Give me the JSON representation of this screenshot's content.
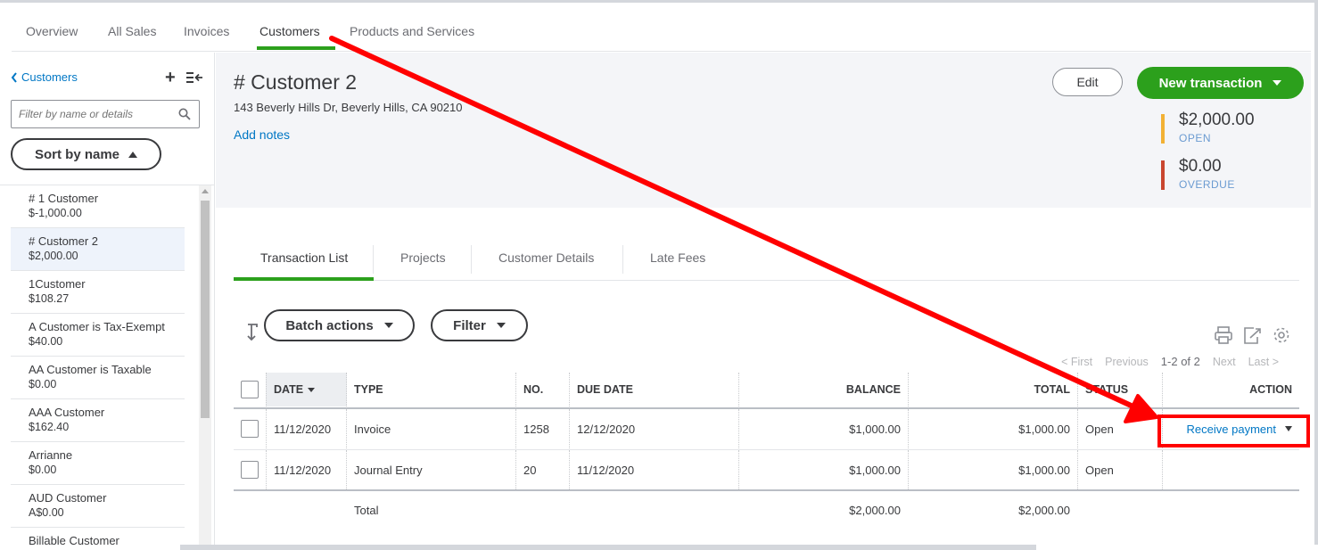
{
  "top_nav": {
    "tabs": [
      {
        "label": "Overview"
      },
      {
        "label": "All Sales"
      },
      {
        "label": "Invoices"
      },
      {
        "label": "Customers"
      },
      {
        "label": "Products and Services"
      }
    ],
    "active_index": 3
  },
  "sidebar": {
    "back_label": "Customers",
    "filter_placeholder": "Filter by name or details",
    "sort_label": "Sort by name",
    "customers": [
      {
        "name": "# 1 Customer",
        "balance": "$-1,000.00"
      },
      {
        "name": "# Customer 2",
        "balance": "$2,000.00",
        "selected": true
      },
      {
        "name": "1Customer",
        "balance": "$108.27"
      },
      {
        "name": "A Customer is Tax-Exempt",
        "balance": "$40.00"
      },
      {
        "name": "AA Customer is Taxable",
        "balance": "$0.00"
      },
      {
        "name": "AAA Customer",
        "balance": "$162.40"
      },
      {
        "name": "Arrianne",
        "balance": "$0.00"
      },
      {
        "name": "AUD Customer",
        "balance": "A$0.00"
      },
      {
        "name": "Billable Customer",
        "balance": ""
      }
    ]
  },
  "header": {
    "title": "# Customer 2",
    "address": "143 Beverly Hills Dr, Beverly Hills, CA 90210",
    "add_notes": "Add notes",
    "edit_label": "Edit",
    "new_transaction_label": "New transaction",
    "open": {
      "value": "$2,000.00",
      "label": "OPEN",
      "color": "#f2b134"
    },
    "overdue": {
      "value": "$0.00",
      "label": "OVERDUE",
      "color": "#c9462f"
    }
  },
  "sub_tabs": {
    "tabs": [
      {
        "label": "Transaction List"
      },
      {
        "label": "Projects"
      },
      {
        "label": "Customer Details"
      },
      {
        "label": "Late Fees"
      }
    ],
    "active_index": 0
  },
  "toolbar": {
    "batch_actions_label": "Batch actions",
    "filter_label": "Filter",
    "icons": [
      "print-icon",
      "export-icon",
      "settings-icon"
    ]
  },
  "pagination": {
    "first": "< First",
    "previous": "Previous",
    "current": "1-2 of 2",
    "next": "Next",
    "last": "Last >"
  },
  "table": {
    "columns": {
      "date": "DATE",
      "type": "TYPE",
      "no": "NO.",
      "due_date": "DUE DATE",
      "balance": "BALANCE",
      "total": "TOTAL",
      "status": "STATUS",
      "action": "ACTION"
    },
    "rows": [
      {
        "date": "11/12/2020",
        "type": "Invoice",
        "no": "1258",
        "due_date": "12/12/2020",
        "balance": "$1,000.00",
        "total": "$1,000.00",
        "status": "Open",
        "action": "Receive payment"
      },
      {
        "date": "11/12/2020",
        "type": "Journal Entry",
        "no": "20",
        "due_date": "11/12/2020",
        "balance": "$1,000.00",
        "total": "$1,000.00",
        "status": "Open",
        "action": ""
      }
    ],
    "totals": {
      "label": "Total",
      "balance": "$2,000.00",
      "total": "$2,000.00"
    }
  },
  "colors": {
    "accent_green": "#2ca01c",
    "link_blue": "#0077c5",
    "annotation_red": "#ff0000"
  }
}
